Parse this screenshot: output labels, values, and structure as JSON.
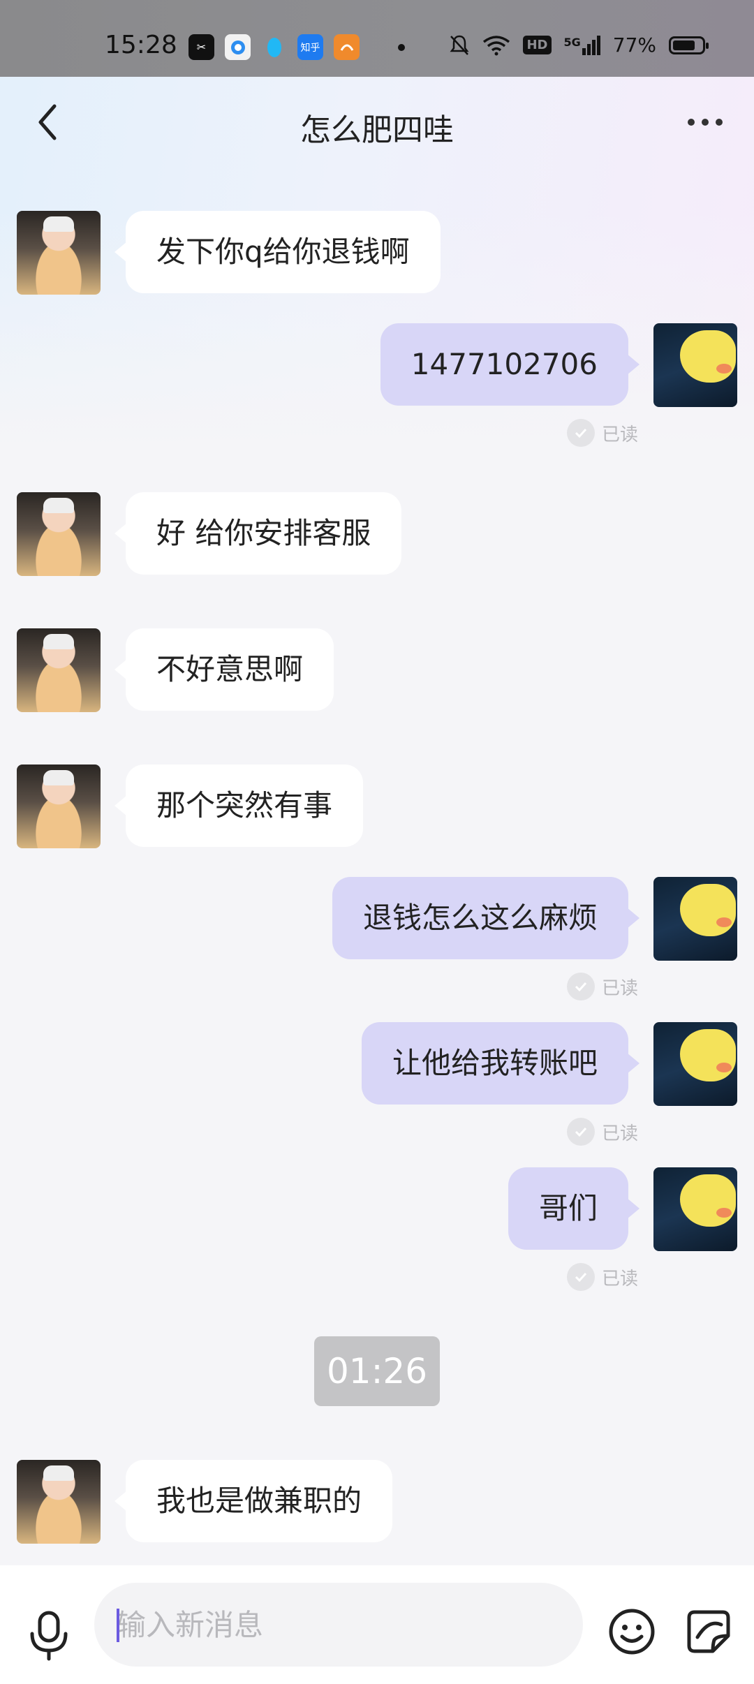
{
  "status_bar": {
    "time": "15:28",
    "battery": "77%",
    "battery_level": 0.77,
    "network": "5G",
    "hd": "HD",
    "app_icons": [
      "capcut-icon",
      "camera-app-icon",
      "qq-icon",
      "zhihu-icon",
      "uc-browser-icon"
    ]
  },
  "header": {
    "title": "怎么肥四哇"
  },
  "messages": [
    {
      "side": "left",
      "text": "发下你q给你退钱啊"
    },
    {
      "side": "right",
      "text": "1477102706",
      "status": "已读"
    },
    {
      "side": "left",
      "text": "好 给你安排客服"
    },
    {
      "side": "left",
      "text": "不好意思啊"
    },
    {
      "side": "left",
      "text": "那个突然有事"
    },
    {
      "side": "right",
      "text": "退钱怎么这么麻烦",
      "status": "已读"
    },
    {
      "side": "right",
      "text": "让他给我转账吧",
      "status": "已读"
    },
    {
      "side": "right",
      "text": "哥们",
      "status": "已读"
    },
    {
      "side": "time",
      "text": "01:26"
    },
    {
      "side": "left",
      "text": "我也是做兼职的"
    }
  ],
  "composer": {
    "placeholder": "输入新消息"
  },
  "colors": {
    "sent_bubble": "#d8d6f7",
    "received_bubble": "#ffffff",
    "caret": "#6b5be0"
  }
}
